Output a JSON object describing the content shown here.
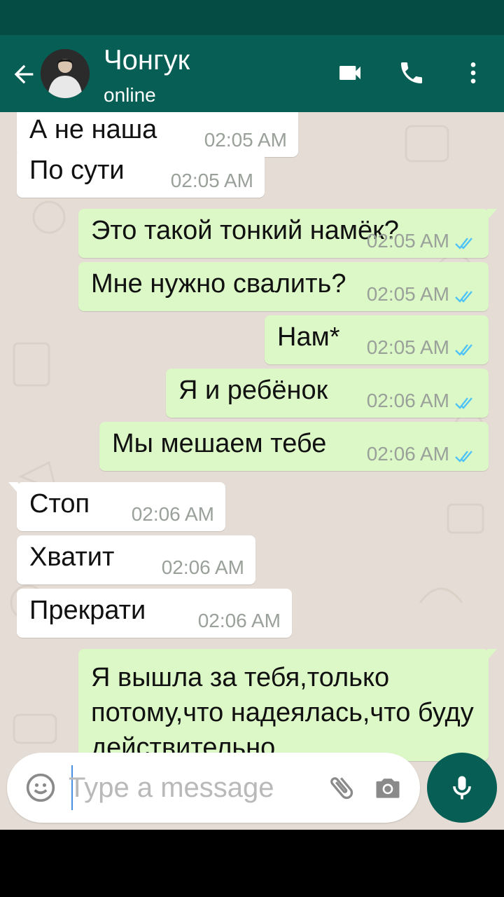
{
  "header": {
    "title": "Чонгук",
    "status": "online"
  },
  "messages": [
    {
      "direction": "in",
      "text": "А не наша",
      "time": "02:05 AM"
    },
    {
      "direction": "in",
      "text": "По сути",
      "time": "02:05 AM"
    },
    {
      "direction": "out",
      "text": "Это такой тонкий намёк?",
      "time": "02:05 AM",
      "read": true
    },
    {
      "direction": "out",
      "text": "Мне нужно свалить?",
      "time": "02:05 AM",
      "read": true
    },
    {
      "direction": "out",
      "text": "Нам*",
      "time": "02:05 AM",
      "read": true
    },
    {
      "direction": "out",
      "text": "Я и ребёнок",
      "time": "02:06 AM",
      "read": true
    },
    {
      "direction": "out",
      "text": "Мы мешаем тебе",
      "time": "02:06 AM",
      "read": true
    },
    {
      "direction": "in",
      "text": "Стоп",
      "time": "02:06 AM"
    },
    {
      "direction": "in",
      "text": "Хватит",
      "time": "02:06 AM"
    },
    {
      "direction": "in",
      "text": "Прекрати",
      "time": "02:06 AM"
    },
    {
      "direction": "out",
      "text": "Я вышла за тебя,только потому,что надеялась,что буду действительно"
    }
  ],
  "composer": {
    "placeholder": "Type a message"
  },
  "icons": {
    "back": "arrow-back-icon",
    "video": "video-call-icon",
    "call": "phone-icon",
    "menu": "more-vert-icon",
    "emoji": "emoji-icon",
    "attach": "paperclip-icon",
    "camera": "camera-icon",
    "mic": "mic-icon"
  },
  "colors": {
    "header": "#075e54",
    "status_bar": "#054d44",
    "outgoing": "#dcf8c6",
    "incoming": "#ffffff",
    "chat_bg": "#e5ddd5",
    "tick": "#4fc3f7"
  }
}
